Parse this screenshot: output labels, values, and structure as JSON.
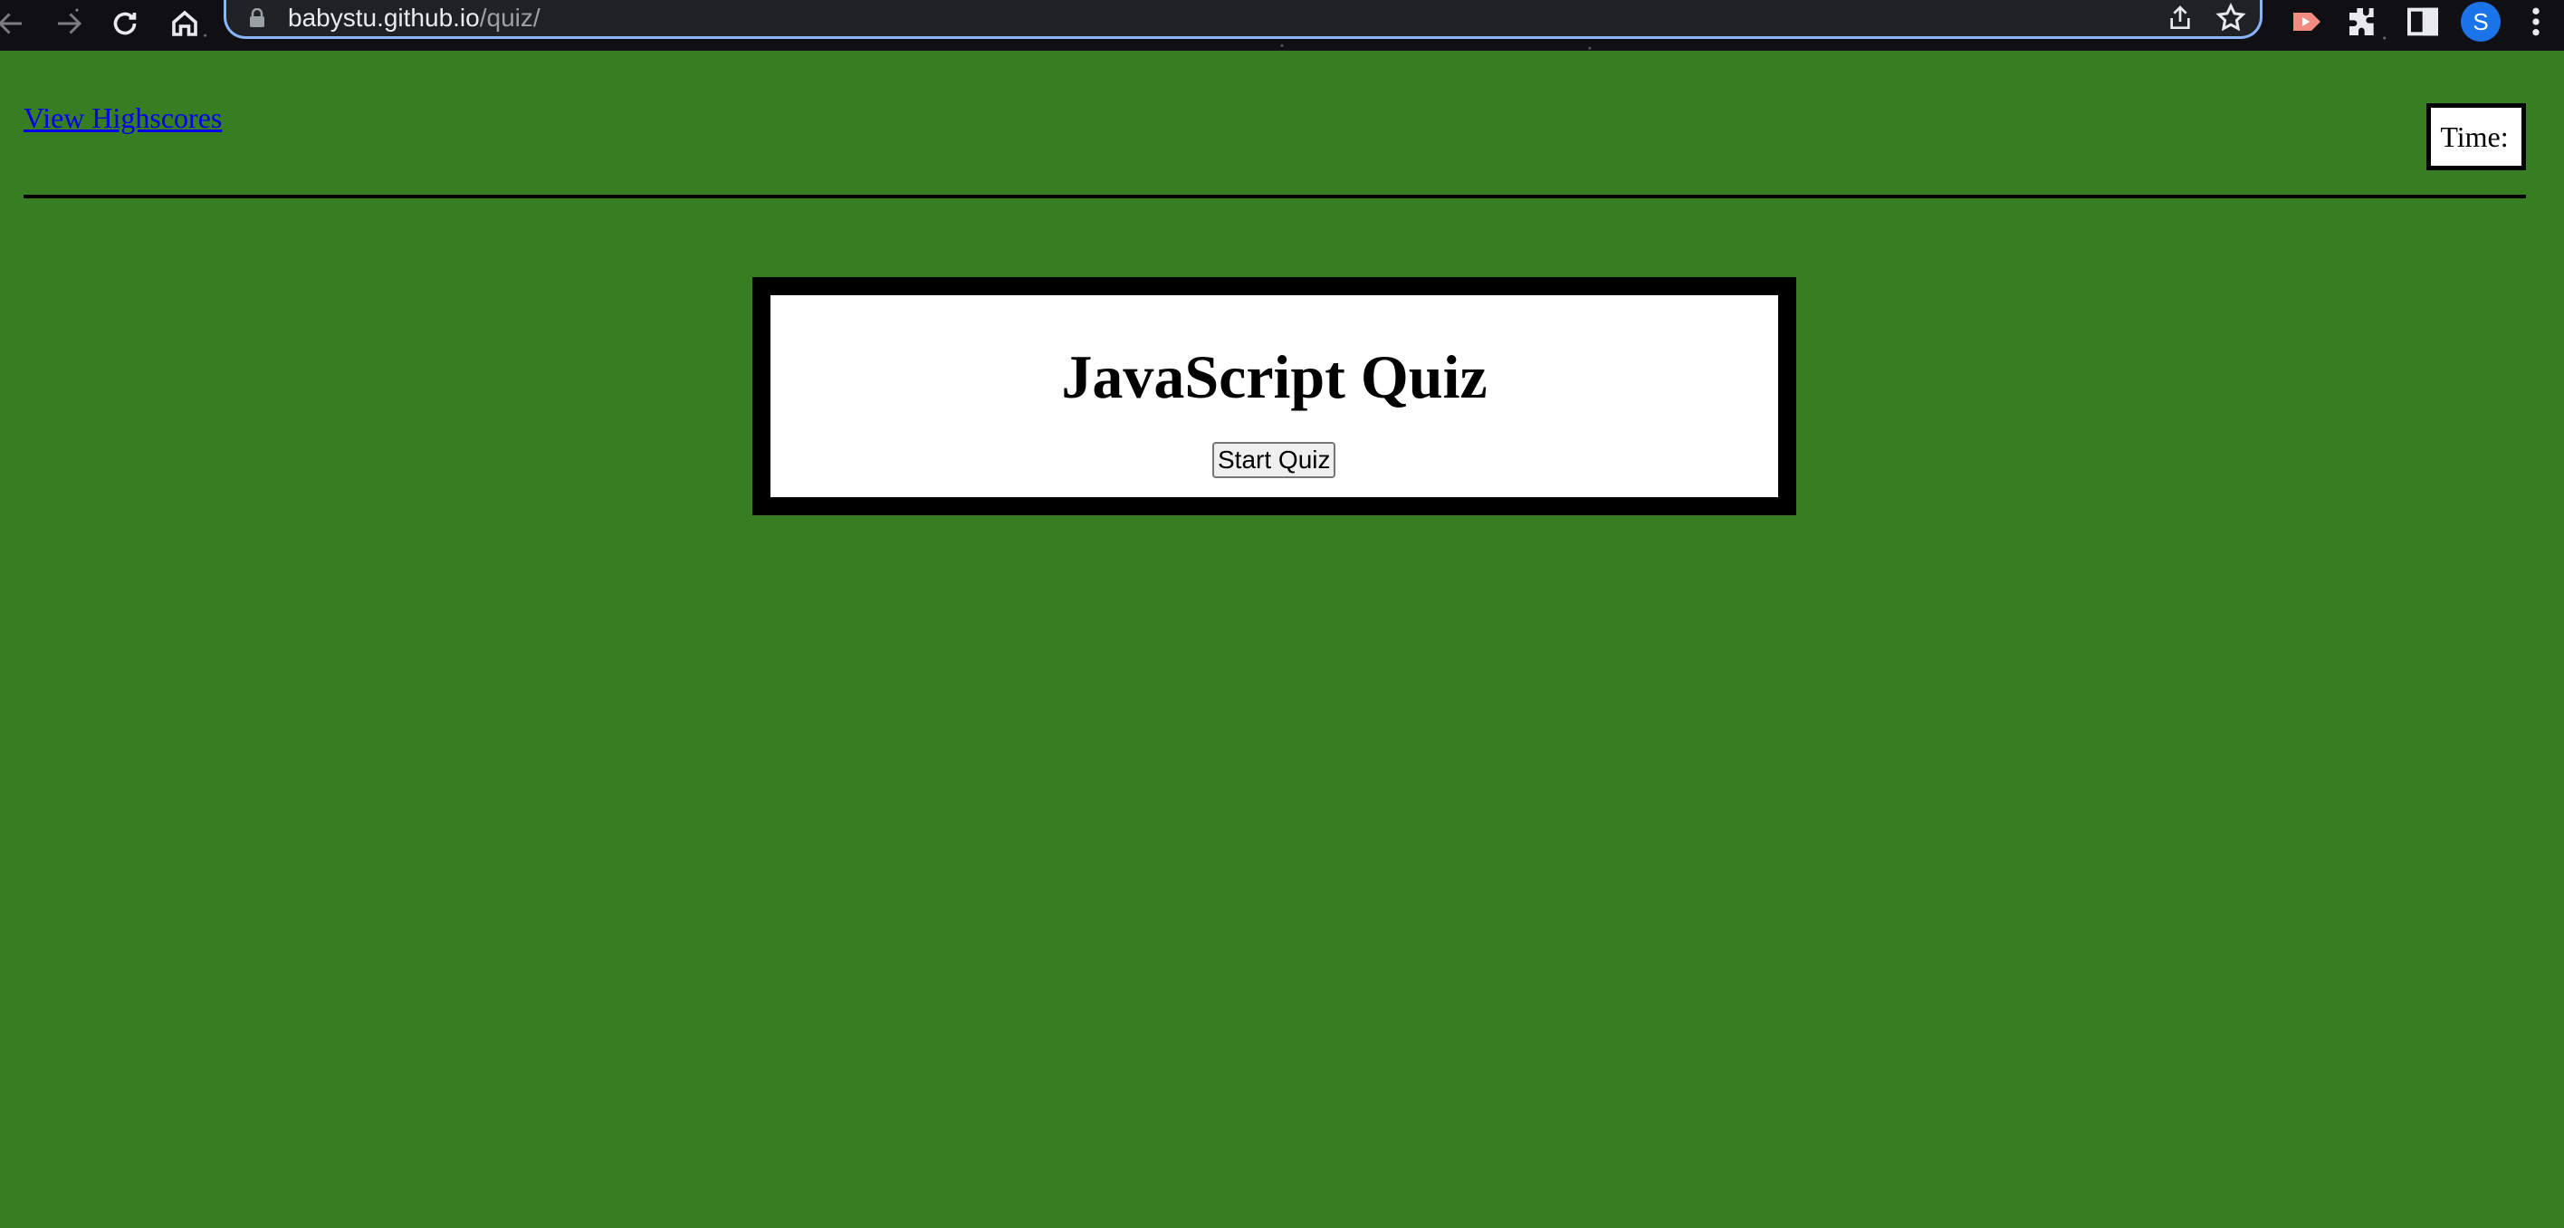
{
  "browser": {
    "url_host": "babystu.github.io",
    "url_path": "/quiz/",
    "icons": [
      "back-icon",
      "forward-icon",
      "reload-icon",
      "home-icon",
      "lock-icon",
      "share-icon",
      "star-icon",
      "extension-icon",
      "puzzle-icon",
      "side-panel-icon",
      "menu-icon"
    ],
    "profile_initial": "S",
    "accent_color": "#8ab4f8"
  },
  "header": {
    "highscores_link": "View Highscores",
    "timer_label": "Time:",
    "timer_value": ""
  },
  "quiz": {
    "title": "JavaScript Quiz",
    "start_button": "Start Quiz"
  },
  "colors": {
    "page_background": "#377d22",
    "card_border": "#000000",
    "link": "#0000ee"
  }
}
